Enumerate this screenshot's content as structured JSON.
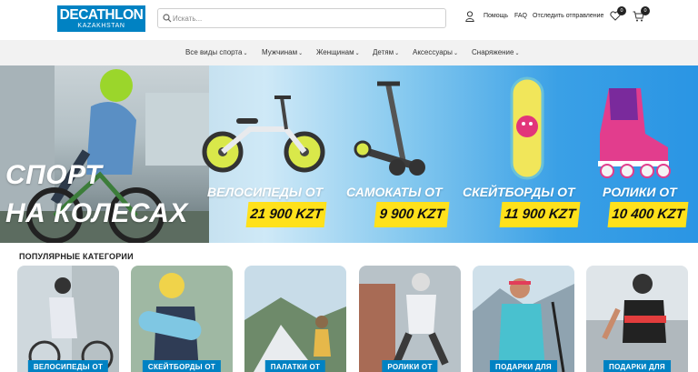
{
  "header": {
    "logo_brand": "DECATHLON",
    "logo_sub": "KAZAKHSTAN",
    "search_placeholder": "Искать...",
    "links": {
      "help": "Помощь",
      "faq": "FAQ",
      "track": "Отследить отправление"
    },
    "wishlist_count": "0",
    "cart_count": "0",
    "icons": [
      "search-icon",
      "user-icon",
      "heart-icon",
      "cart-icon"
    ]
  },
  "nav": {
    "items": [
      {
        "label": "Все виды спорта"
      },
      {
        "label": "Мужчинам"
      },
      {
        "label": "Женщинам"
      },
      {
        "label": "Детям"
      },
      {
        "label": "Аксессуары"
      },
      {
        "label": "Снаряжение"
      }
    ]
  },
  "hero": {
    "title_line1": "СПОРТ",
    "title_line2": "НА КОЛЕСАХ",
    "products": [
      {
        "label": "ВЕЛОСИПЕДЫ ОТ",
        "price": "21 900 KZT"
      },
      {
        "label": "САМОКАТЫ ОТ",
        "price": "9 900 KZT"
      },
      {
        "label": "СКЕЙТБОРДЫ ОТ",
        "price": "11 900 KZT"
      },
      {
        "label": "РОЛИКИ ОТ",
        "price": "10 400 KZT"
      }
    ]
  },
  "categories": {
    "title": "ПОПУЛЯРНЫЕ КАТЕГОРИИ",
    "cards": [
      {
        "label": "ВЕЛОСИПЕДЫ ОТ"
      },
      {
        "label": "СКЕЙТБОРДЫ ОТ"
      },
      {
        "label": "ПАЛАТКИ ОТ"
      },
      {
        "label": "РОЛИКИ ОТ"
      },
      {
        "label": "ПОДАРКИ ДЛЯ"
      },
      {
        "label": "ПОДАРКИ ДЛЯ"
      }
    ]
  },
  "colors": {
    "brand_blue": "#0082c3",
    "price_yellow": "#ffe11b",
    "nav_bg": "#f2f2f2"
  }
}
